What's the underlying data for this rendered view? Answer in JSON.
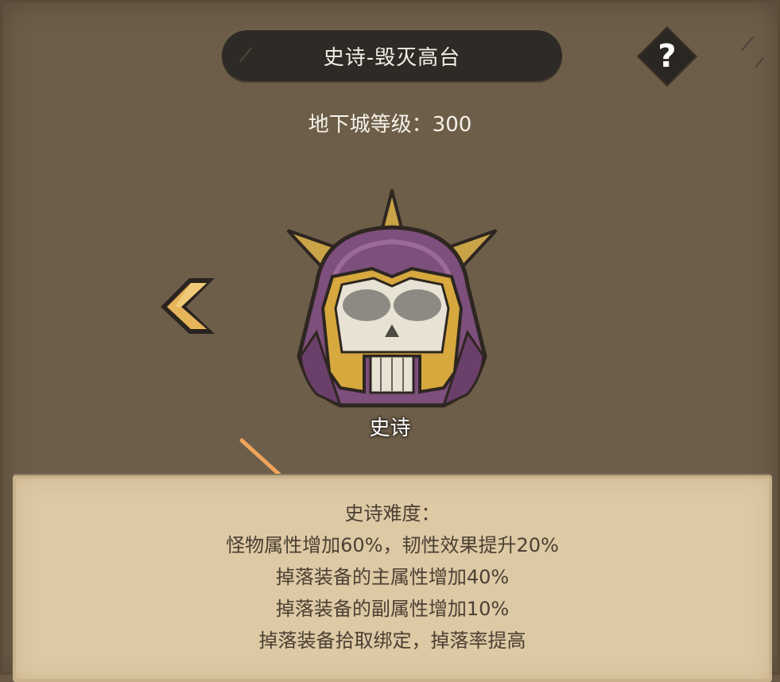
{
  "header": {
    "title": "史诗-毁灭高台",
    "help_label": "?"
  },
  "dungeon": {
    "level_text": "地下城等级：300"
  },
  "difficulty": {
    "label": "史诗",
    "icon": "armored-skull-icon"
  },
  "navigation": {
    "prev_icon": "chevron-left-icon"
  },
  "description": {
    "heading": "史诗难度：",
    "lines": [
      "怪物属性增加60%，韧性效果提升20%",
      "掉落装备的主属性增加40%",
      "掉落装备的副属性增加10%",
      "掉落装备拾取绑定，掉落率提高"
    ]
  },
  "colors": {
    "background": "#6d5e49",
    "title_pill": "#2e2a26",
    "panel": "#ddc9a4",
    "accent_gold": "#d9a84a",
    "hood_purple": "#7d4f7c",
    "annotation_arrow": "#f0a35a"
  }
}
